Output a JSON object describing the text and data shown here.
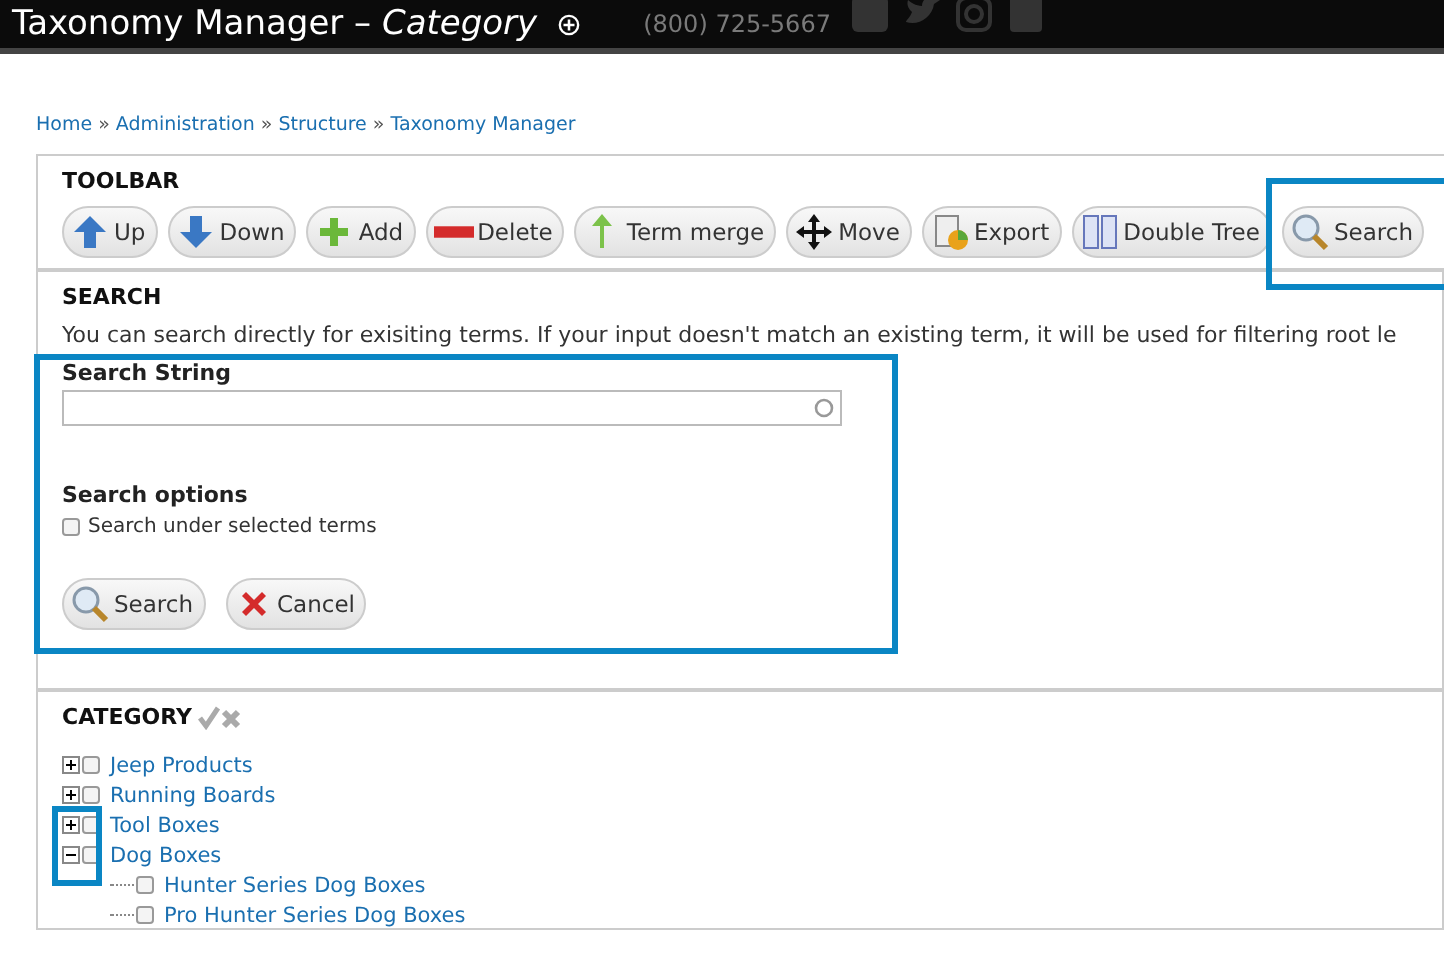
{
  "header": {
    "title": "Taxonomy Manager",
    "dash": "–",
    "subtitle": "Category",
    "phone": "(800) 725-5667"
  },
  "breadcrumb": [
    "Home",
    "Administration",
    "Structure",
    "Taxonomy Manager"
  ],
  "breadcrumb_separator": "»",
  "toolbar": {
    "legend": "TOOLBAR",
    "buttons": [
      {
        "label": "Up",
        "kind": "up",
        "highlighted": false
      },
      {
        "label": "Down",
        "kind": "down",
        "highlighted": false
      },
      {
        "label": "Add",
        "kind": "add",
        "highlighted": false
      },
      {
        "label": "Delete",
        "kind": "delete",
        "highlighted": false
      },
      {
        "label": "Term merge",
        "kind": "merge",
        "highlighted": false
      },
      {
        "label": "Move",
        "kind": "move",
        "highlighted": false
      },
      {
        "label": "Export",
        "kind": "export",
        "highlighted": false
      },
      {
        "label": "Double Tree",
        "kind": "double",
        "highlighted": false
      },
      {
        "label": "Search",
        "kind": "search",
        "highlighted": true
      }
    ]
  },
  "search": {
    "legend": "SEARCH",
    "description": "You can search directly for exisiting terms. If your input doesn't match an existing term, it will be used for filtering root le",
    "highlighted": true,
    "string_label": "Search String",
    "options_label": "Search options",
    "option": {
      "label": "Search under selected terms",
      "checked": false
    },
    "buttons": [
      {
        "label": "Search",
        "kind": "search"
      },
      {
        "label": "Cancel",
        "kind": "cancel"
      }
    ]
  },
  "category": {
    "legend": "CATEGORY",
    "toggles_highlighted": true,
    "terms": [
      {
        "label": "Jeep Products",
        "expanded": false,
        "checked": false
      },
      {
        "label": "Running Boards",
        "expanded": false,
        "checked": false
      },
      {
        "label": "Tool Boxes",
        "expanded": false,
        "checked": false
      },
      {
        "label": "Dog Boxes",
        "expanded": true,
        "checked": false,
        "children": [
          {
            "label": "Hunter Series Dog Boxes",
            "checked": false
          },
          {
            "label": "Pro Hunter Series Dog Boxes",
            "checked": false
          }
        ]
      }
    ]
  }
}
